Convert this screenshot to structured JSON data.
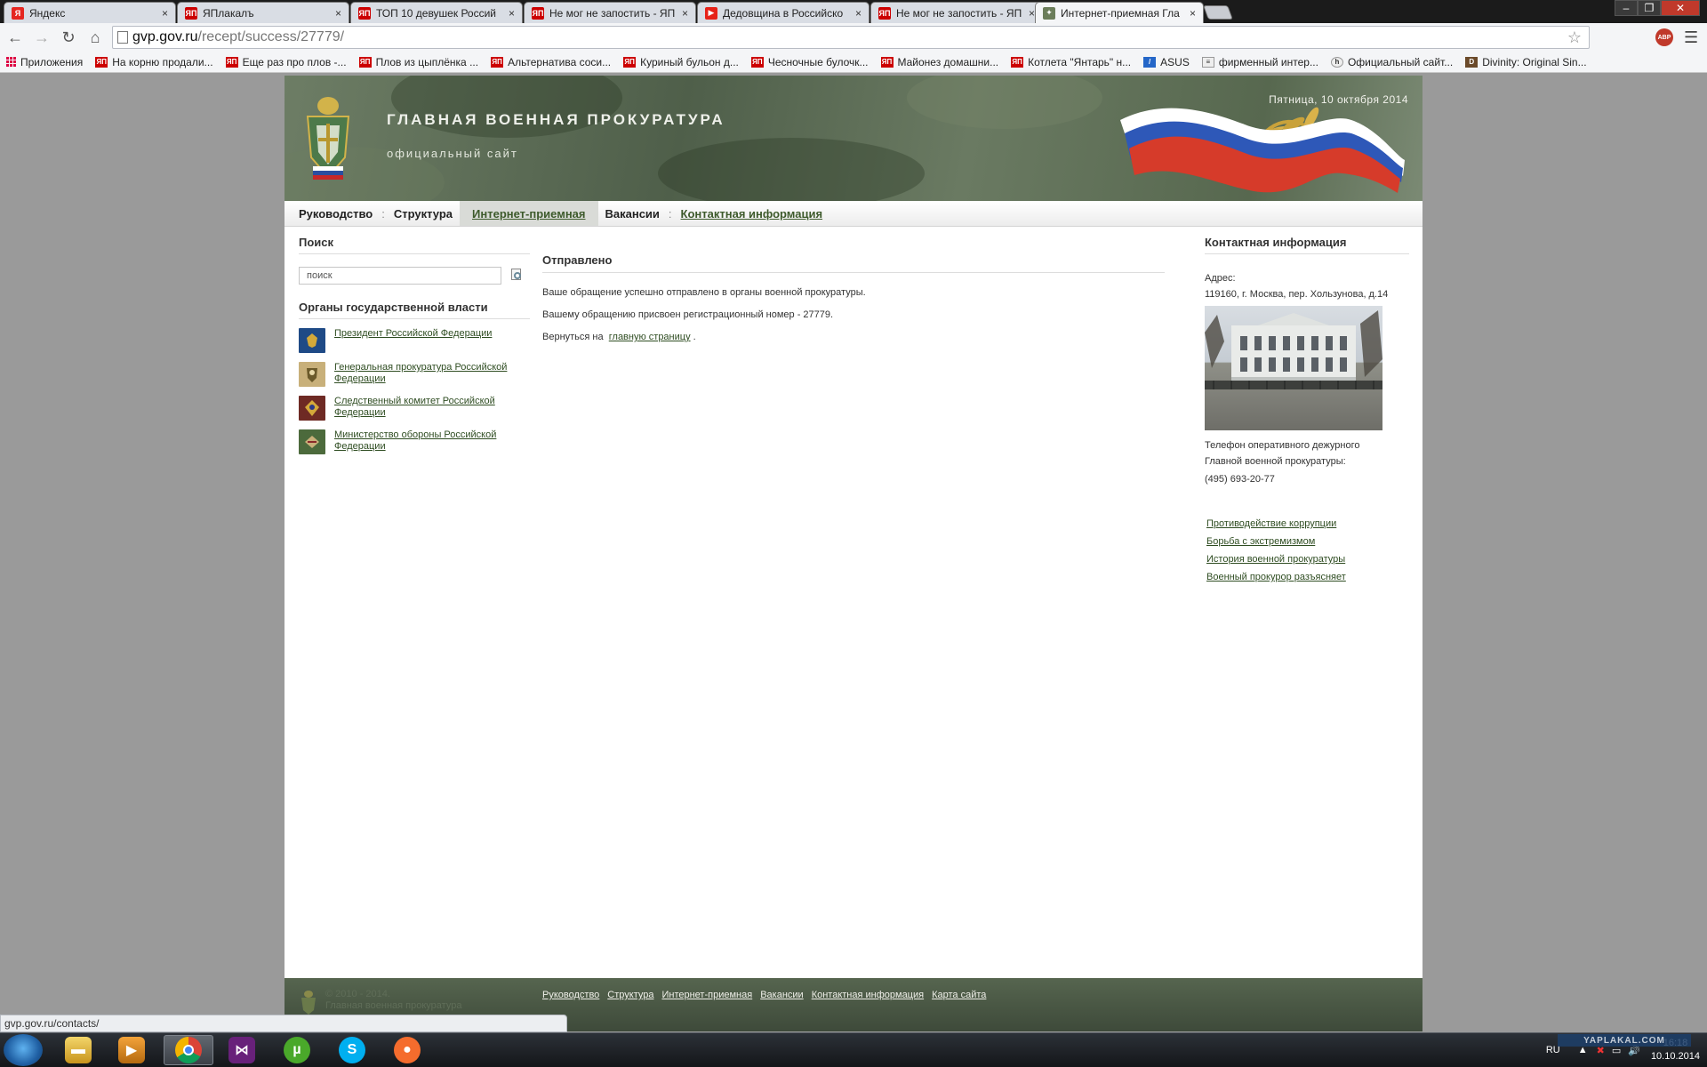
{
  "browser": {
    "tabs": [
      {
        "label": "Яндекс",
        "icon": "yandex-icon",
        "color": "#e52620",
        "active": false
      },
      {
        "label": "ЯПлакалъ",
        "icon": "yaplakal-icon",
        "color": "#cc0000",
        "active": false
      },
      {
        "label": "ТОП 10 девушек Россий",
        "icon": "yaplakal-icon",
        "color": "#cc0000",
        "active": false
      },
      {
        "label": "Не мог не запостить - ЯП",
        "icon": "yaplakal-icon",
        "color": "#cc0000",
        "active": false
      },
      {
        "label": "Дедовщина в Российско",
        "icon": "youtube-icon",
        "color": "#e62117",
        "active": false
      },
      {
        "label": "Не мог не запостить - ЯП",
        "icon": "yaplakal-icon",
        "color": "#cc0000",
        "active": false
      },
      {
        "label": "Интернет-приемная Гла",
        "icon": "emblem-icon",
        "color": "#6b7d5a",
        "active": true
      }
    ],
    "close_glyph": "×",
    "url_host": "gvp.gov.ru",
    "url_path": "/recept/success/27779/",
    "bookmarks": [
      {
        "label": "Приложения",
        "icon": "apps-icon"
      },
      {
        "label": "На корню продали...",
        "icon": "yaplakal-icon"
      },
      {
        "label": "Еще раз про плов -...",
        "icon": "yaplakal-icon"
      },
      {
        "label": "Плов из цыплёнка ...",
        "icon": "yaplakal-icon"
      },
      {
        "label": "Альтернатива соси...",
        "icon": "yaplakal-icon"
      },
      {
        "label": "Куриный бульон д...",
        "icon": "yaplakal-icon"
      },
      {
        "label": "Чесночные булочк...",
        "icon": "yaplakal-icon"
      },
      {
        "label": "Майонез домашни...",
        "icon": "yaplakal-icon"
      },
      {
        "label": "Котлета \"Янтарь\" н...",
        "icon": "yaplakal-icon"
      },
      {
        "label": "ASUS",
        "icon": "asus-icon"
      },
      {
        "label": "фирменный интер...",
        "icon": "page-icon"
      },
      {
        "label": "Официальный сайт...",
        "icon": "h-icon"
      },
      {
        "label": "Divinity: Original Sin...",
        "icon": "game-icon"
      }
    ],
    "status_url": "gvp.gov.ru/contacts/"
  },
  "site": {
    "title": "ГЛАВНАЯ ВОЕННАЯ ПРОКУРАТУРА",
    "subtitle": "официальный сайт",
    "date": "Пятница, 10 октября 2014",
    "nav": [
      {
        "label": "Руководство"
      },
      {
        "label": "Структура"
      },
      {
        "label": "Интернет-приемная"
      },
      {
        "label": "Вакансии"
      },
      {
        "label": "Контактная информация"
      }
    ],
    "nav_separator": ":"
  },
  "left": {
    "search_title": "Поиск",
    "search_value": "поиск",
    "organs_title": "Органы государственной власти",
    "organs": [
      {
        "label": "Президент Российской Федерации",
        "color": "#1f4a86"
      },
      {
        "label": "Генеральная прокуратура Российской Федерации",
        "color": "#c8b07a"
      },
      {
        "label": "Следственный комитет Российской Федерации",
        "color": "#6e2a24"
      },
      {
        "label": "Министерство обороны Российской Федерации",
        "color": "#4c6a3c"
      }
    ]
  },
  "main": {
    "heading": "Отправлено",
    "line1": "Ваше обращение успешно отправлено в органы военной прокуратуры.",
    "line2": "Вашему обращению присвоен регистрационный номер - 27779.",
    "back_prefix": "Вернуться на",
    "back_link": "главную страницу",
    "back_suffix": "."
  },
  "right": {
    "title": "Контактная информация",
    "address_label": "Адрес:",
    "address": "119160, г. Москва, пер. Хользунова, д.14",
    "phone_label_1": "Телефон оперативного дежурного",
    "phone_label_2": "Главной военной прокуратуры:",
    "phone": "(495) 693-20-77",
    "links": [
      "Противодействие коррупции",
      "Борьба с экстремизмом",
      "История военной прокуратуры",
      "Военный прокурор разъясняет"
    ]
  },
  "footer": {
    "copyright_1": "© 2010 - 2014.",
    "copyright_2": "Главная военная прокуратура",
    "links": [
      "Руководство",
      "Структура",
      "Интернет-приемная",
      "Вакансии",
      "Контактная информация",
      "Карта сайта"
    ]
  },
  "taskbar": {
    "lang": "RU",
    "time": "16:18",
    "date": "10.10.2014",
    "watermark": "YAPLAKAL.COM"
  }
}
